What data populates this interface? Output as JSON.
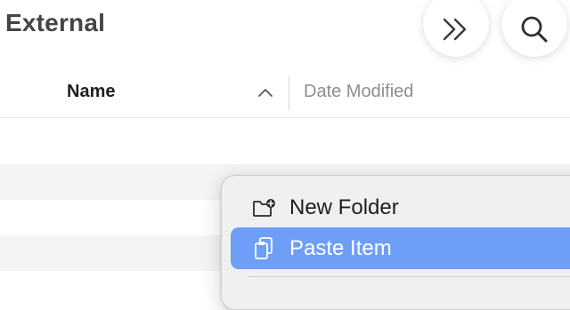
{
  "header": {
    "title": "External",
    "forward_icon": "double-chevron-right-icon",
    "search_icon": "magnifying-glass-icon"
  },
  "columns": {
    "name_label": "Name",
    "name_sort": "ascending",
    "sort_icon": "chevron-up-icon",
    "date_label": "Date Modified"
  },
  "context_menu": {
    "items": [
      {
        "label": "New Folder",
        "icon": "folder-plus-icon",
        "highlighted": false
      },
      {
        "label": "Paste Item",
        "icon": "clipboard-icon",
        "highlighted": true
      }
    ]
  },
  "colors": {
    "highlight": "#6e9ef8",
    "title_text": "#454545",
    "stripe": "#f4f4f4",
    "secondary_text": "#8e8e8e"
  }
}
